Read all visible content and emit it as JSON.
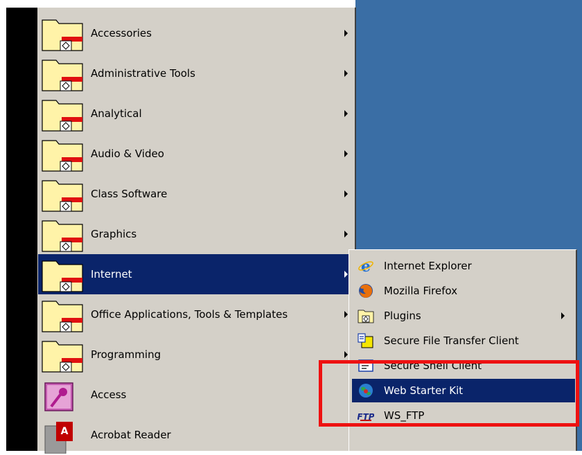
{
  "start_menu": {
    "items": [
      {
        "label": "Accessories",
        "icon": "program-folder-icon",
        "submenu": true
      },
      {
        "label": "Administrative Tools",
        "icon": "program-folder-icon",
        "submenu": true
      },
      {
        "label": "Analytical",
        "icon": "program-folder-icon",
        "submenu": true
      },
      {
        "label": "Audio & Video",
        "icon": "program-folder-icon",
        "submenu": true
      },
      {
        "label": "Class Software",
        "icon": "program-folder-icon",
        "submenu": true
      },
      {
        "label": "Graphics",
        "icon": "program-folder-icon",
        "submenu": true
      },
      {
        "label": "Internet",
        "icon": "program-folder-icon",
        "submenu": true,
        "active": true
      },
      {
        "label": "Office Applications, Tools & Templates",
        "icon": "program-folder-icon",
        "submenu": true
      },
      {
        "label": "Programming",
        "icon": "program-folder-icon",
        "submenu": true
      },
      {
        "label": "Access",
        "icon": "access-key-icon",
        "submenu": false
      },
      {
        "label": "Acrobat Reader",
        "icon": "acrobat-reader-icon",
        "submenu": false
      }
    ]
  },
  "internet_submenu": {
    "items": [
      {
        "label": "Internet Explorer",
        "icon": "internet-explorer-icon"
      },
      {
        "label": "Mozilla Firefox",
        "icon": "firefox-icon"
      },
      {
        "label": "Plugins",
        "icon": "program-folder-icon",
        "submenu": true
      },
      {
        "label": "Secure File Transfer Client",
        "icon": "secure-file-transfer-icon"
      },
      {
        "label": "Secure Shell Client",
        "icon": "secure-shell-icon"
      },
      {
        "label": "Web Starter Kit",
        "icon": "web-starter-kit-icon",
        "active": true
      },
      {
        "label": "WS_FTP",
        "icon": "ws-ftp-icon"
      }
    ]
  },
  "colors": {
    "menu_background": "#d4d0c8",
    "selection": "#0a246a",
    "desktop": "#3a6ea5",
    "highlight_box": "#ee1111"
  }
}
